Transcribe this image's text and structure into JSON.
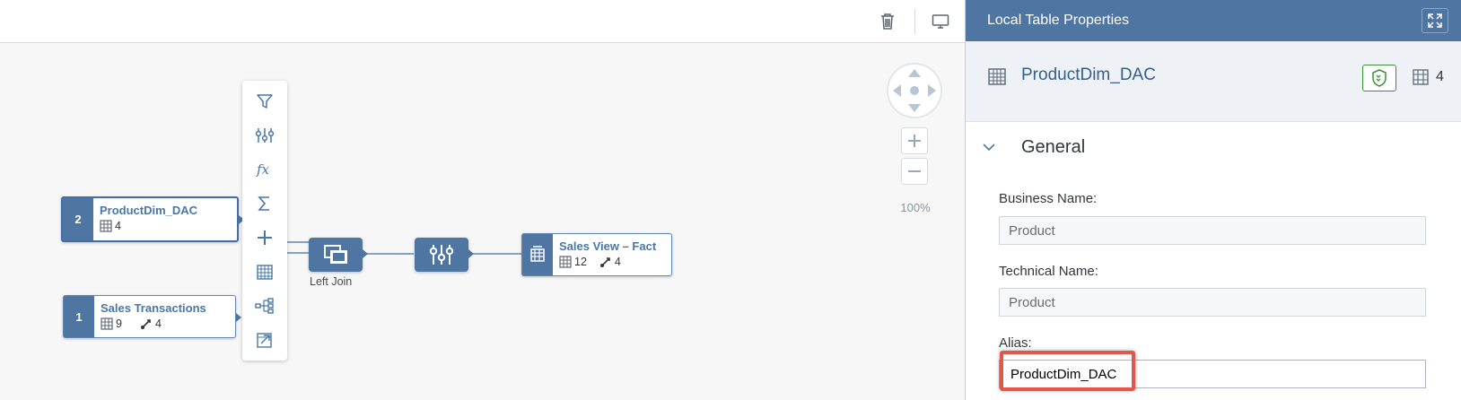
{
  "canvas": {
    "toolbar": {
      "delete_icon": "trash-icon",
      "view_icon": "monitor-icon"
    },
    "nodes": [
      {
        "number": "2",
        "name": "ProductDim_DAC",
        "columns": "4",
        "associations": "",
        "selected": true
      },
      {
        "number": "1",
        "name": "Sales Transactions",
        "columns": "9",
        "associations": "4",
        "selected": false
      }
    ],
    "operators": {
      "join_label": "Left Join",
      "join_icon": "join-icon",
      "projection_icon": "projection-icon"
    },
    "output_node": {
      "name": "Sales View – Fact",
      "columns": "12",
      "associations": "4"
    },
    "palette": [
      "filter-icon",
      "projection-icon",
      "calculated-column-icon",
      "aggregation-icon",
      "add-icon",
      "table-icon",
      "hierarchy-icon",
      "open-in-editor-icon"
    ],
    "zoom_level": "100%"
  },
  "panel": {
    "title": "Local Table Properties",
    "object_name": "ProductDim_DAC",
    "column_count": "4",
    "section_title": "General",
    "fields": {
      "business_name": {
        "label": "Business Name:",
        "value": "Product"
      },
      "technical_name": {
        "label": "Technical Name:",
        "value": "Product"
      },
      "alias": {
        "label": "Alias:",
        "value": "ProductDim_DAC"
      }
    }
  },
  "colors": {
    "accent": "#4f75a3",
    "highlight": "#e2574c",
    "shield_green": "#3f8f3a"
  }
}
